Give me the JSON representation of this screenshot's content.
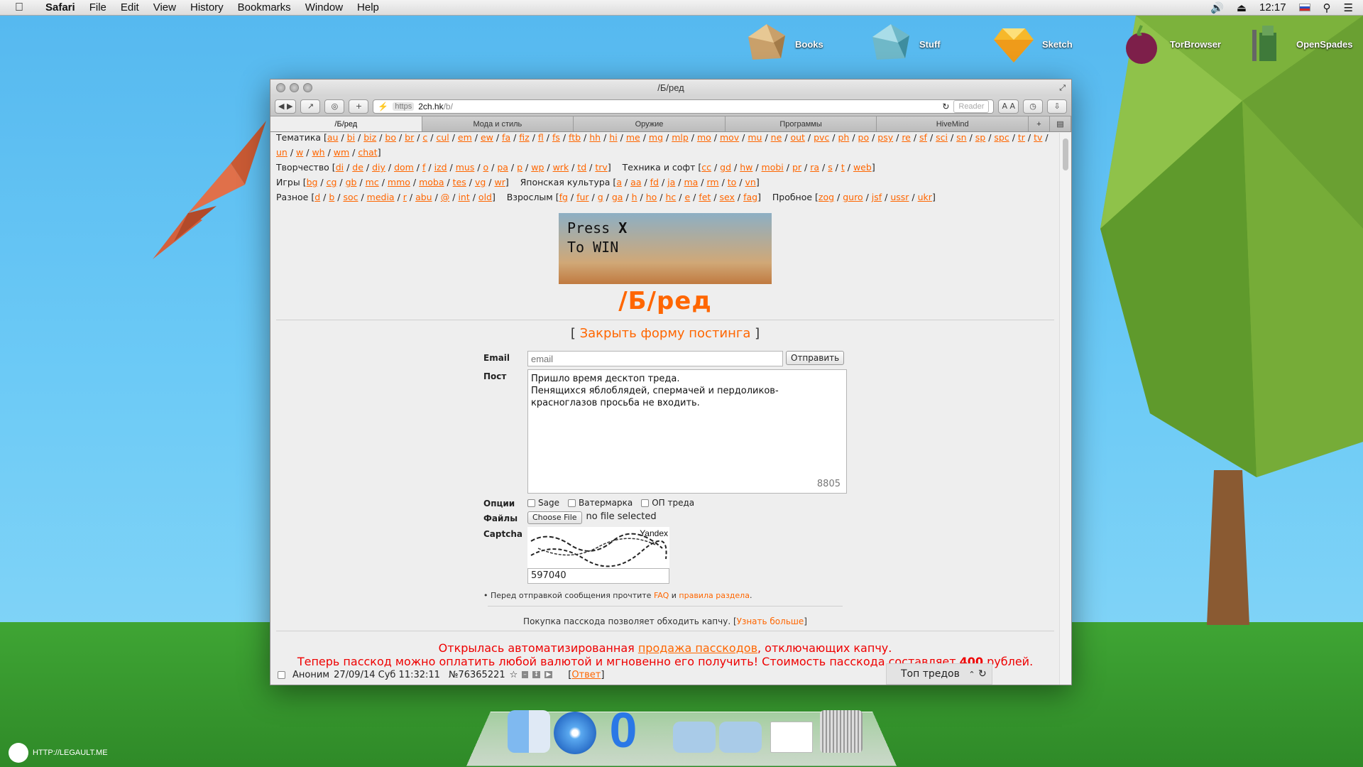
{
  "menubar": {
    "app": "Safari",
    "items": [
      "File",
      "Edit",
      "View",
      "History",
      "Bookmarks",
      "Window",
      "Help"
    ],
    "clock": "12:17"
  },
  "desktop_icons": [
    {
      "label": "Books",
      "icon": "books-icon"
    },
    {
      "label": "Stuff",
      "icon": "stuff-icon"
    },
    {
      "label": "Sketch",
      "icon": "sketch-icon"
    },
    {
      "label": "TorBrowser",
      "icon": "torbrowser-icon"
    },
    {
      "label": "OpenSpades",
      "icon": "openspades-icon"
    }
  ],
  "window": {
    "title": "/Б/ред",
    "url_scheme": "https",
    "url_host": "2ch.hk",
    "url_path": "/b/",
    "reader": "Reader",
    "tabs": [
      "/Б/ред",
      "Мода и стиль",
      "Оружие",
      "Программы",
      "HiveMind"
    ]
  },
  "nav": {
    "line1_prefix": "Тематика [",
    "line1_links": [
      "au",
      "bi",
      "biz",
      "bo",
      "br",
      "c",
      "cul",
      "em",
      "ew",
      "fa",
      "fiz",
      "fl",
      "fs",
      "ftb",
      "hh",
      "hi",
      "me",
      "mg",
      "mlp",
      "mo",
      "mov",
      "mu",
      "ne",
      "out",
      "pvc",
      "ph",
      "po",
      "psy",
      "re",
      "sf",
      "sci",
      "sn",
      "sp",
      "spc",
      "tr",
      "tv",
      "un",
      "w",
      "wh",
      "wm",
      "chat"
    ],
    "creative_prefix": "Творчество [",
    "creative_links": [
      "di",
      "de",
      "diy",
      "dom",
      "f",
      "izd",
      "mus",
      "o",
      "pa",
      "p",
      "wp",
      "wrk",
      "td",
      "trv"
    ],
    "tech_prefix": "Техника и софт [",
    "tech_links": [
      "cc",
      "gd",
      "hw",
      "mobi",
      "pr",
      "ra",
      "s",
      "t",
      "web"
    ],
    "games_prefix": "Игры [",
    "games_links": [
      "bg",
      "cg",
      "gb",
      "mc",
      "mmo",
      "moba",
      "tes",
      "vg",
      "wr"
    ],
    "japan_prefix": "Японская культура [",
    "japan_links": [
      "a",
      "aa",
      "fd",
      "ja",
      "ma",
      "rm",
      "to",
      "vn"
    ],
    "misc_prefix": "Разное [",
    "misc_links": [
      "d",
      "b",
      "soc",
      "media",
      "r",
      "abu",
      "@",
      "int",
      "old"
    ],
    "adult_prefix": "Взрослым [",
    "adult_links": [
      "fg",
      "fur",
      "g",
      "ga",
      "h",
      "ho",
      "hc",
      "e",
      "fet",
      "sex",
      "fag"
    ],
    "test_prefix": "Пробное [",
    "test_links": [
      "zog",
      "guro",
      "jsf",
      "ussr",
      "ukr"
    ]
  },
  "banner": {
    "line1": "Press ",
    "line1_key": "X",
    "line2": "To WIN"
  },
  "board_title": "/Б/ред",
  "form": {
    "toggle_left": "[ ",
    "toggle_link": "Закрыть форму постинга",
    "toggle_right": " ]",
    "email_label": "Email",
    "email_placeholder": "email",
    "send_label": "Отправить",
    "post_label": "Пост",
    "post_text": "Пришло время десктоп треда.\nПенящихся яблоблядей, спермачей и пердоликов-\nкрасноглазов просьба не входить.",
    "char_count": "8805",
    "options_label": "Опции",
    "opt_sage": "Sage",
    "opt_watermark": "Ватермарка",
    "opt_op": "ОП треда",
    "files_label": "Файлы",
    "choose_file": "Choose File",
    "no_file": "no file selected",
    "captcha_label": "Captcha",
    "captcha_brand": "Yandex",
    "captcha_value": "597040",
    "note_prefix": "• Перед отправкой сообщения прочтите ",
    "note_faq": "FAQ",
    "note_and": " и ",
    "note_rules": "правила раздела",
    "note_end": "."
  },
  "passcode": {
    "text": "Покупка пасскода позволяет обходить капчу. [",
    "link": "Узнать больше",
    "end": "]"
  },
  "alert": {
    "line1_a": "Открылась автоматизированная ",
    "line1_link": "продажа пасскодов",
    "line1_b": ", отключающих капчу.",
    "line2_a": "Теперь пасскод можно оплатить любой валютой и мгновенно его получить! Стоимость пасскода составляет ",
    "line2_price": "400",
    "line2_b": " рублей."
  },
  "thread": {
    "author": "Аноним",
    "date": "27/09/14 Суб 11:32:11",
    "num": "№76365221",
    "reply_left": "[",
    "reply": "Ответ",
    "reply_right": "]",
    "top_threads": "Топ тредов"
  },
  "watermark": "HTTP://LEGAULT.ME",
  "colors": {
    "accent": "#ff6600",
    "alert": "#ee0000",
    "sky": "#5fc0f2",
    "ground": "#3fa534"
  }
}
